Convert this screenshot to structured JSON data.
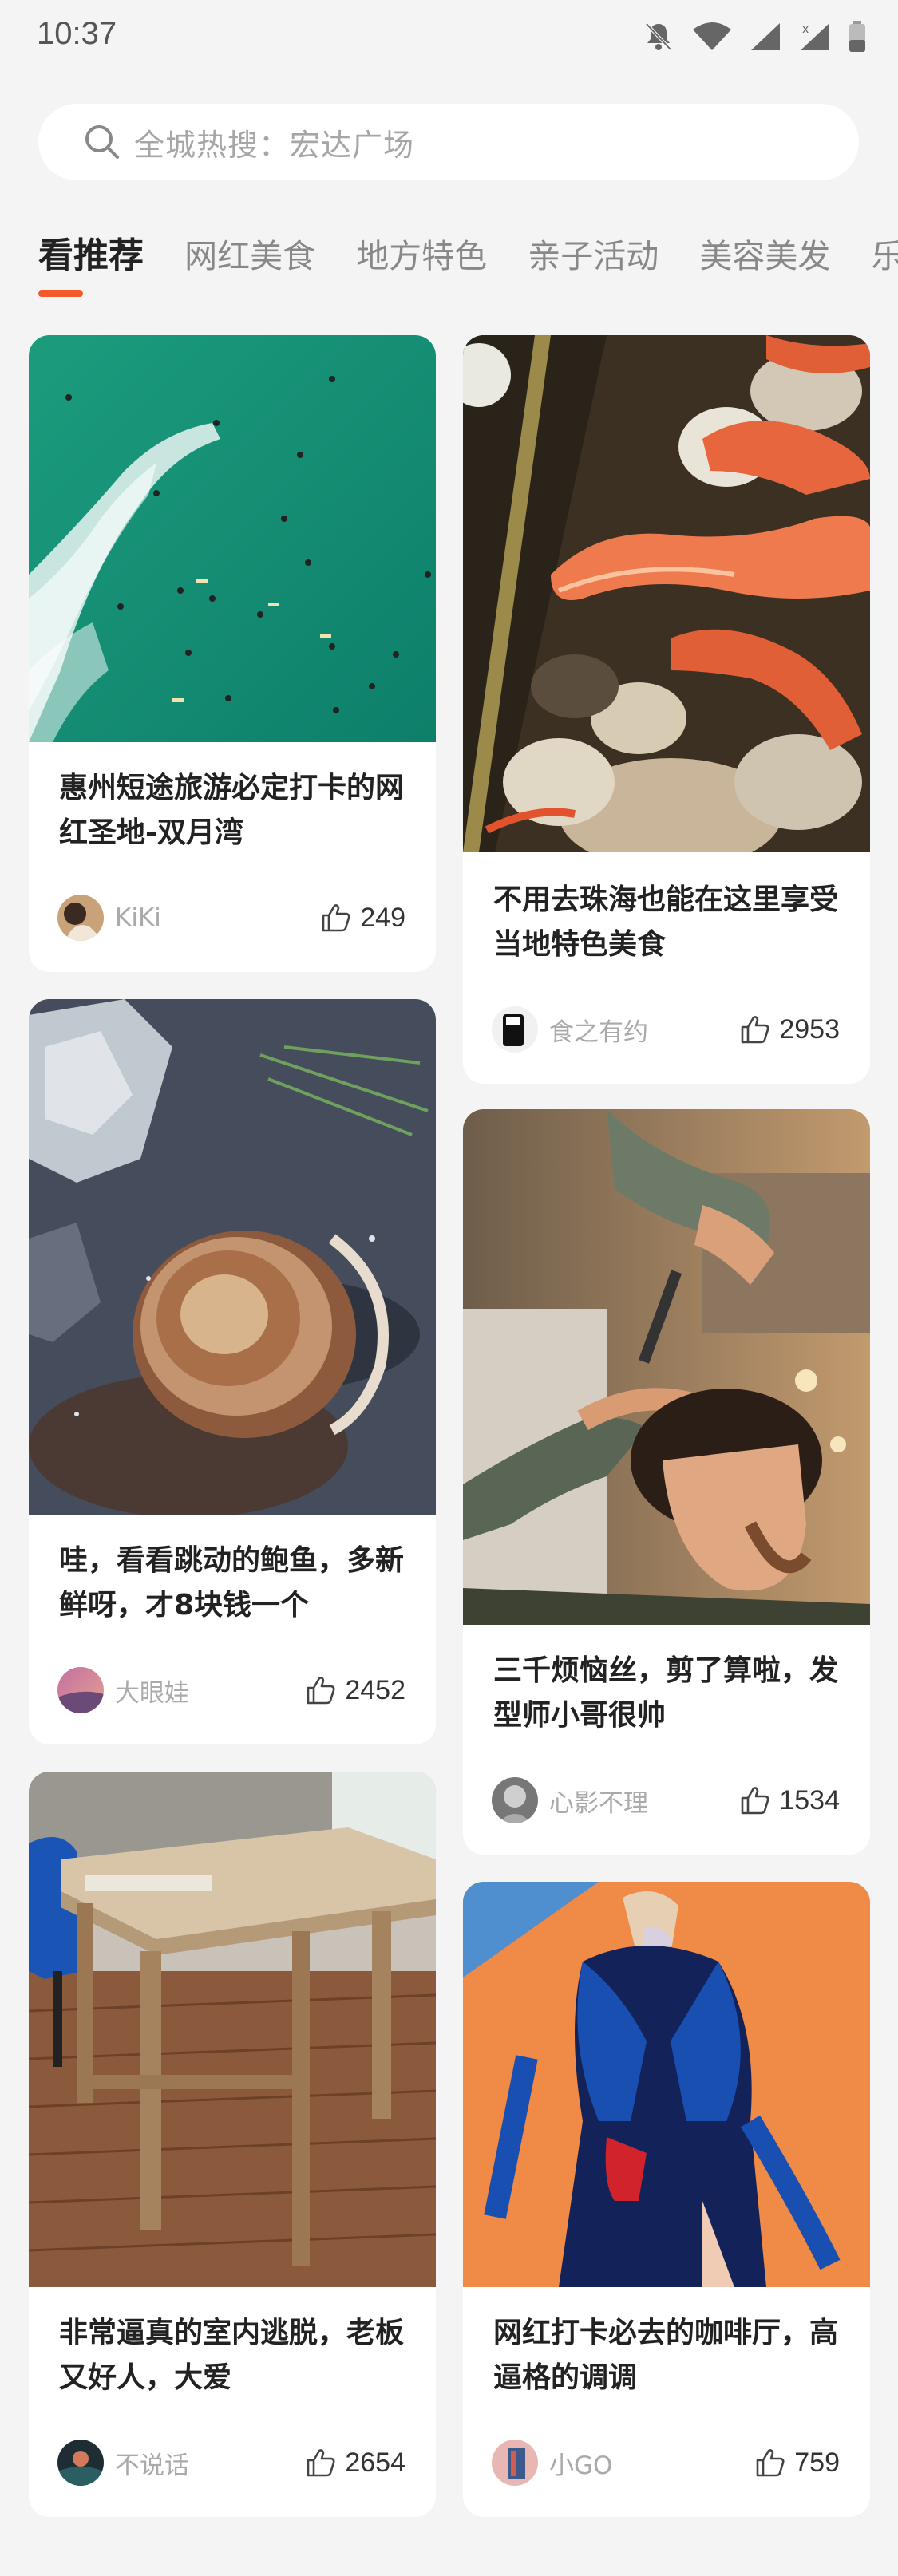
{
  "status": {
    "time": "10:37"
  },
  "search": {
    "placeholder": "全城热搜：宏达广场"
  },
  "tabs": [
    {
      "label": "看推荐",
      "active": true
    },
    {
      "label": "网红美食"
    },
    {
      "label": "地方特色"
    },
    {
      "label": "亲子活动"
    },
    {
      "label": "美容美发"
    },
    {
      "label": "乐"
    }
  ],
  "cards": [
    {
      "title": "惠州短途旅游必定打卡的网红圣地-双月湾",
      "author": "KiKi",
      "likes": "249"
    },
    {
      "title": "不用去珠海也能在这里享受当地特色美食",
      "author": "食之有约",
      "likes": "2953"
    },
    {
      "title": "哇，看看跳动的鲍鱼，多新鲜呀，才8块钱一个",
      "author": "大眼娃",
      "likes": "2452"
    },
    {
      "title": "三千烦恼丝，剪了算啦，发型师小哥很帅",
      "author": "心影不理",
      "likes": "1534"
    },
    {
      "title": "非常逼真的室内逃脱，老板又好人，大爱",
      "author": "不说话",
      "likes": "2654"
    },
    {
      "title": "网红打卡必去的咖啡厅，高逼格的调调",
      "author": "小GO",
      "likes": "759"
    }
  ],
  "colors": {
    "accent": "#f25a2c",
    "background": "#f4f4f4"
  }
}
